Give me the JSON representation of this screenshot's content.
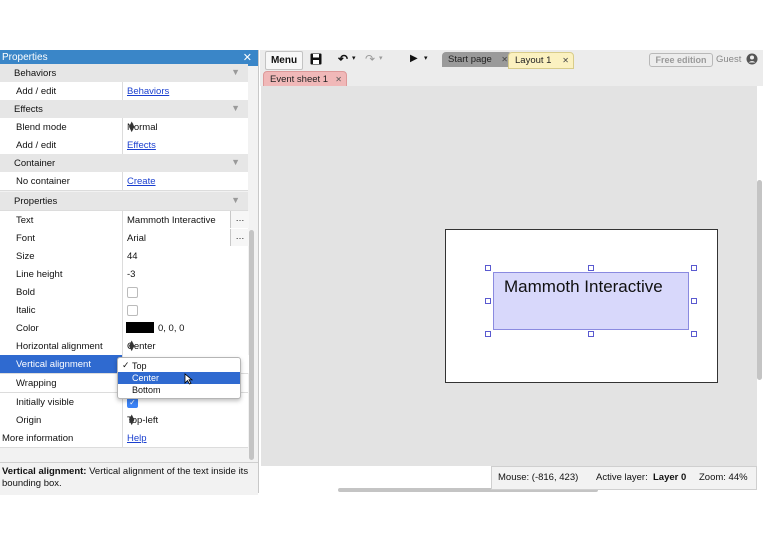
{
  "properties_panel": {
    "title": "Properties",
    "close_glyph": "✕",
    "rows": {
      "behaviors_section": "Behaviors",
      "behaviors_key": "Add / edit",
      "behaviors_link": "Behaviors",
      "effects_section": "Effects",
      "blend_mode_key": "Blend mode",
      "blend_mode_value": "Normal",
      "effects_key": "Add / edit",
      "effects_link": "Effects",
      "container_section": "Container",
      "container_key": "No container",
      "container_link": "Create",
      "properties_section": "Properties",
      "text_key": "Text",
      "text_value": "Mammoth Interactive",
      "font_key": "Font",
      "font_value": "Arial",
      "size_key": "Size",
      "size_value": "44",
      "line_height_key": "Line height",
      "line_height_value": "-3",
      "bold_key": "Bold",
      "italic_key": "Italic",
      "color_key": "Color",
      "color_value": "0, 0, 0",
      "horizontal_alignment_key": "Horizontal alignment",
      "horizontal_alignment_value": "Center",
      "vertical_alignment_key": "Vertical alignment",
      "wrapping_key": "Wrapping",
      "initially_visible_key": "Initially visible",
      "origin_key": "Origin",
      "origin_value": "Top-left",
      "more_info_key": "More information",
      "more_info_link": "Help"
    },
    "bold_checked": false,
    "italic_checked": false,
    "initially_visible_checked": true,
    "color_swatch": "#000000",
    "description_bold": "Vertical alignment:",
    "description_text": "Vertical alignment of the text inside its bounding box."
  },
  "dropdown": {
    "options": [
      "Top",
      "Center",
      "Bottom"
    ],
    "checked": "Top",
    "highlighted": "Center",
    "check_glyph": "✓"
  },
  "toolbar": {
    "menu_label": "Menu",
    "save_icon": "floppy-disk-icon",
    "undo_glyph": "↶",
    "redo_glyph": "↷",
    "play_glyph": "▶",
    "tabs": [
      {
        "label": "Start page",
        "close": "✕"
      },
      {
        "label": "Layout 1",
        "close": "✕"
      }
    ],
    "free_edition_label": "Free edition",
    "guest_label": "Guest"
  },
  "sheet_tabs": [
    {
      "label": "Event sheet 1",
      "close": "✕"
    }
  ],
  "layout": {
    "text_object_content": "Mammoth Interactive"
  },
  "status_bar": {
    "mouse_label": "Mouse: (-816, 423)",
    "active_layer_prefix": "Active layer:",
    "active_layer_value": "Layer 0",
    "zoom_label": "Zoom: 44%"
  },
  "colors": {
    "panel_header": "#3a86c8",
    "selection": "#2f6ad0",
    "link": "#1a3fcf",
    "start_tab": "#9a9a9a",
    "layout_tab": "#fbf1c0",
    "event_sheet_tab": "#f0b8b8"
  }
}
